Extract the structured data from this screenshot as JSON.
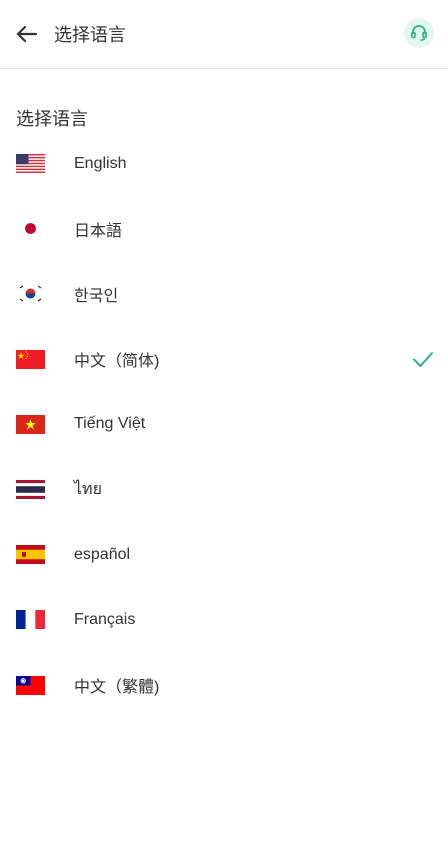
{
  "header": {
    "title": "选择语言",
    "back_icon": "arrow-left-icon",
    "support_icon": "headset-icon",
    "accent": "#2bb37f"
  },
  "section": {
    "title": "选择语言"
  },
  "languages": [
    {
      "label": "English",
      "flag": "us-flag-icon",
      "selected": false
    },
    {
      "label": "日本語",
      "flag": "japan-flag-icon",
      "selected": false
    },
    {
      "label": "한국인",
      "flag": "korea-flag-icon",
      "selected": false
    },
    {
      "label": "中文（简体)",
      "flag": "china-flag-icon",
      "selected": true
    },
    {
      "label": "Tiếng Việt",
      "flag": "vietnam-flag-icon",
      "selected": false
    },
    {
      "label": "ไทย",
      "flag": "thailand-flag-icon",
      "selected": false
    },
    {
      "label": "español",
      "flag": "spain-flag-icon",
      "selected": false
    },
    {
      "label": "Français",
      "flag": "france-flag-icon",
      "selected": false
    },
    {
      "label": "中文（繁體)",
      "flag": "taiwan-flag-icon",
      "selected": false
    }
  ]
}
